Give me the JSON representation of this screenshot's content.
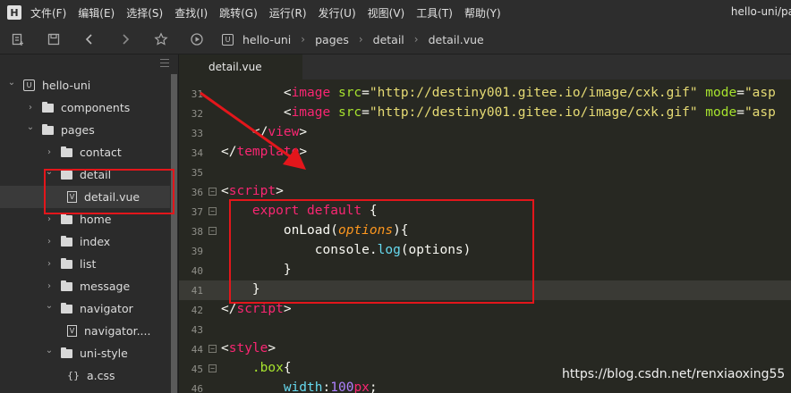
{
  "app": {
    "logo": "H",
    "window_title": "hello-uni/pa"
  },
  "menu": [
    "文件(F)",
    "编辑(E)",
    "选择(S)",
    "查找(I)",
    "跳转(G)",
    "运行(R)",
    "发行(U)",
    "视图(V)",
    "工具(T)",
    "帮助(Y)"
  ],
  "toolbar": {
    "icons": [
      "new-file-icon",
      "save-icon",
      "back-icon",
      "forward-icon",
      "star-icon",
      "run-icon"
    ],
    "breadcrumb": [
      "hello-uni",
      "pages",
      "detail",
      "detail.vue"
    ]
  },
  "sidebar": {
    "items": [
      {
        "label": "hello-uni",
        "type": "project",
        "expanded": true,
        "depth": 0
      },
      {
        "label": "components",
        "type": "folder",
        "expanded": false,
        "depth": 1
      },
      {
        "label": "pages",
        "type": "folder",
        "expanded": true,
        "depth": 1
      },
      {
        "label": "contact",
        "type": "folder",
        "expanded": false,
        "depth": 2
      },
      {
        "label": "detail",
        "type": "folder",
        "expanded": true,
        "depth": 2
      },
      {
        "label": "detail.vue",
        "type": "vue",
        "depth": 3,
        "selected": true
      },
      {
        "label": "home",
        "type": "folder",
        "expanded": false,
        "depth": 2
      },
      {
        "label": "index",
        "type": "folder",
        "expanded": false,
        "depth": 2
      },
      {
        "label": "list",
        "type": "folder",
        "expanded": false,
        "depth": 2
      },
      {
        "label": "message",
        "type": "folder",
        "expanded": false,
        "depth": 2
      },
      {
        "label": "navigator",
        "type": "folder",
        "expanded": true,
        "depth": 2
      },
      {
        "label": "navigator....",
        "type": "vue",
        "depth": 3
      },
      {
        "label": "uni-style",
        "type": "folder",
        "expanded": true,
        "depth": 2
      },
      {
        "label": "a.css",
        "type": "css",
        "depth": 3
      }
    ]
  },
  "editor": {
    "tab": "detail.vue",
    "lines": [
      {
        "n": "31",
        "indent": "        ",
        "tokens": [
          [
            "t-pun",
            "<"
          ],
          [
            "t-tag",
            "image"
          ],
          [
            "t-pun",
            " "
          ],
          [
            "t-attr",
            "src"
          ],
          [
            "t-pun",
            "="
          ],
          [
            "t-str",
            "\"http://destiny001.gitee.io/image/cxk.gif\""
          ],
          [
            "t-pun",
            " "
          ],
          [
            "t-attr",
            "mode"
          ],
          [
            "t-pun",
            "="
          ],
          [
            "t-str",
            "\"asp"
          ]
        ]
      },
      {
        "n": "32",
        "indent": "        ",
        "tokens": [
          [
            "t-pun",
            "<"
          ],
          [
            "t-tag",
            "image"
          ],
          [
            "t-pun",
            " "
          ],
          [
            "t-attr",
            "src"
          ],
          [
            "t-pun",
            "="
          ],
          [
            "t-str",
            "\"http://destiny001.gitee.io/image/cxk.gif\""
          ],
          [
            "t-pun",
            " "
          ],
          [
            "t-attr",
            "mode"
          ],
          [
            "t-pun",
            "="
          ],
          [
            "t-str",
            "\"asp"
          ]
        ]
      },
      {
        "n": "33",
        "indent": "    ",
        "tokens": [
          [
            "t-pun",
            "</"
          ],
          [
            "t-tag",
            "view"
          ],
          [
            "t-pun",
            ">"
          ]
        ]
      },
      {
        "n": "34",
        "indent": "",
        "tokens": [
          [
            "t-pun",
            "</"
          ],
          [
            "t-tag",
            "template"
          ],
          [
            "t-pun",
            ">"
          ]
        ]
      },
      {
        "n": "35",
        "indent": "",
        "tokens": []
      },
      {
        "n": "36",
        "indent": "",
        "fold": "−",
        "tokens": [
          [
            "t-pun",
            "<"
          ],
          [
            "t-tag",
            "script"
          ],
          [
            "t-pun",
            ">"
          ]
        ]
      },
      {
        "n": "37",
        "indent": "    ",
        "fold": "−",
        "tokens": [
          [
            "t-kw",
            "export default"
          ],
          [
            "t-pun",
            " {"
          ]
        ]
      },
      {
        "n": "38",
        "indent": "        ",
        "fold": "−",
        "tokens": [
          [
            "t-fn",
            "onLoad"
          ],
          [
            "t-pun",
            "("
          ],
          [
            "t-param",
            "options"
          ],
          [
            "t-pun",
            "){"
          ]
        ]
      },
      {
        "n": "39",
        "indent": "            ",
        "tokens": [
          [
            "t-fn",
            "console"
          ],
          [
            "t-pun",
            "."
          ],
          [
            "t-method",
            "log"
          ],
          [
            "t-pun",
            "(options)"
          ]
        ]
      },
      {
        "n": "40",
        "indent": "        ",
        "tokens": [
          [
            "t-pun",
            "}"
          ]
        ]
      },
      {
        "n": "41",
        "indent": "    ",
        "current": true,
        "tokens": [
          [
            "t-pun",
            "}"
          ]
        ]
      },
      {
        "n": "42",
        "indent": "",
        "tokens": [
          [
            "t-pun",
            "</"
          ],
          [
            "t-tag",
            "script"
          ],
          [
            "t-pun",
            ">"
          ]
        ]
      },
      {
        "n": "43",
        "indent": "",
        "tokens": []
      },
      {
        "n": "44",
        "indent": "",
        "fold": "−",
        "tokens": [
          [
            "t-pun",
            "<"
          ],
          [
            "t-tag",
            "style"
          ],
          [
            "t-pun",
            ">"
          ]
        ]
      },
      {
        "n": "45",
        "indent": "    ",
        "fold": "−",
        "tokens": [
          [
            "t-attr",
            ".box"
          ],
          [
            "t-pun",
            "{"
          ]
        ]
      },
      {
        "n": "46",
        "indent": "        ",
        "tokens": [
          [
            "t-method",
            "width"
          ],
          [
            "t-pun",
            ":"
          ],
          [
            "t-num",
            "100"
          ],
          [
            "t-kw",
            "px"
          ],
          [
            "t-pun",
            ";"
          ]
        ]
      }
    ]
  },
  "annotation": {
    "watermark": "https://blog.csdn.net/renxiaoxing55",
    "highlight_color": "#e3161b"
  }
}
